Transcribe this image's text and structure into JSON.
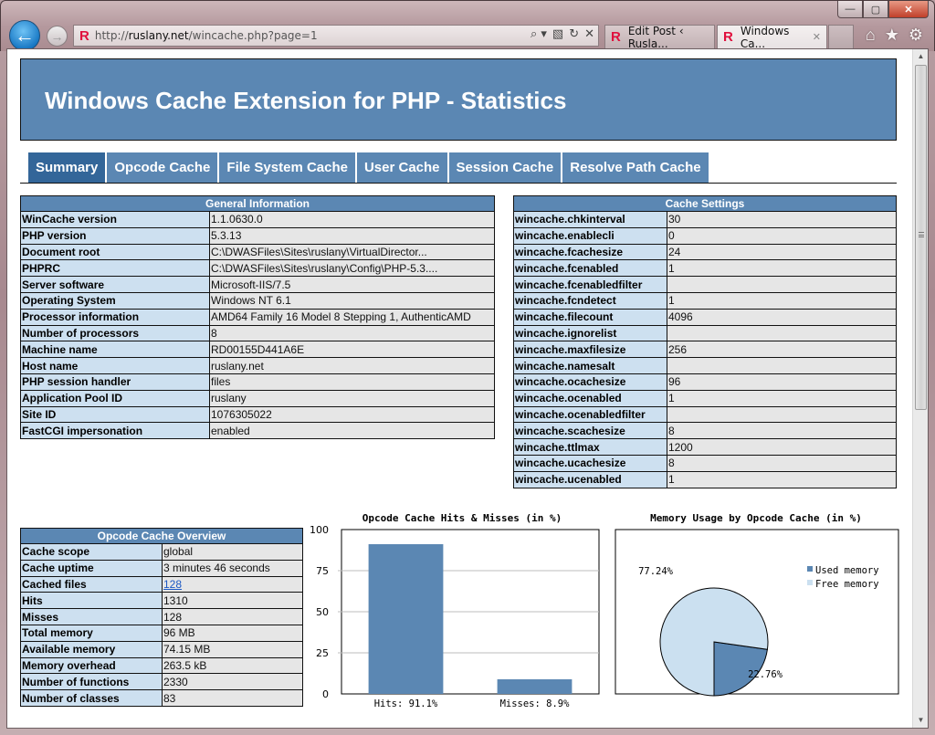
{
  "browser": {
    "address_url_prefix": "http://",
    "address_url_host": "ruslany.net",
    "address_url_path": "/wincache.php?page=1",
    "tabs": [
      {
        "label": "Edit Post ‹ Rusla...",
        "active": false
      },
      {
        "label": "Windows Ca...",
        "active": true
      }
    ],
    "favicon_glyph": "R",
    "window_controls": {
      "minimize": "—",
      "maximize": "▢",
      "close": "✕"
    },
    "icons": {
      "back": "🡐",
      "forward": "→",
      "search": "⌕ ▾",
      "compat": "▧",
      "refresh": "↻",
      "stop": "✕",
      "home": "⌂",
      "favorites": "★",
      "tools": "⚙",
      "tab_close": "✕"
    }
  },
  "header": {
    "title": "Windows Cache Extension for PHP - Statistics"
  },
  "nav_tabs": [
    {
      "label": "Summary",
      "active": true
    },
    {
      "label": "Opcode Cache",
      "active": false
    },
    {
      "label": "File System Cache",
      "active": false
    },
    {
      "label": "User Cache",
      "active": false
    },
    {
      "label": "Session Cache",
      "active": false
    },
    {
      "label": "Resolve Path Cache",
      "active": false
    }
  ],
  "general_info": {
    "title": "General Information",
    "rows": [
      {
        "key": "WinCache version",
        "value": "1.1.0630.0"
      },
      {
        "key": "PHP version",
        "value": "5.3.13"
      },
      {
        "key": "Document root",
        "value": "C:\\DWASFiles\\Sites\\ruslany\\VirtualDirector..."
      },
      {
        "key": "PHPRC",
        "value": "C:\\DWASFiles\\Sites\\ruslany\\Config\\PHP-5.3...."
      },
      {
        "key": "Server software",
        "value": "Microsoft-IIS/7.5"
      },
      {
        "key": "Operating System",
        "value": "Windows NT 6.1"
      },
      {
        "key": "Processor information",
        "value": "AMD64 Family 16 Model 8 Stepping 1, AuthenticAMD"
      },
      {
        "key": "Number of processors",
        "value": "8"
      },
      {
        "key": "Machine name",
        "value": "RD00155D441A6E"
      },
      {
        "key": "Host name",
        "value": "ruslany.net"
      },
      {
        "key": "PHP session handler",
        "value": "files"
      },
      {
        "key": "Application Pool ID",
        "value": "ruslany"
      },
      {
        "key": "Site ID",
        "value": "1076305022"
      },
      {
        "key": "FastCGI impersonation",
        "value": "enabled"
      }
    ]
  },
  "cache_settings": {
    "title": "Cache Settings",
    "rows": [
      {
        "key": "wincache.chkinterval",
        "value": "30"
      },
      {
        "key": "wincache.enablecli",
        "value": "0"
      },
      {
        "key": "wincache.fcachesize",
        "value": "24"
      },
      {
        "key": "wincache.fcenabled",
        "value": "1"
      },
      {
        "key": "wincache.fcenabledfilter",
        "value": ""
      },
      {
        "key": "wincache.fcndetect",
        "value": "1"
      },
      {
        "key": "wincache.filecount",
        "value": "4096"
      },
      {
        "key": "wincache.ignorelist",
        "value": ""
      },
      {
        "key": "wincache.maxfilesize",
        "value": "256"
      },
      {
        "key": "wincache.namesalt",
        "value": ""
      },
      {
        "key": "wincache.ocachesize",
        "value": "96"
      },
      {
        "key": "wincache.ocenabled",
        "value": "1"
      },
      {
        "key": "wincache.ocenabledfilter",
        "value": ""
      },
      {
        "key": "wincache.scachesize",
        "value": "8"
      },
      {
        "key": "wincache.ttlmax",
        "value": "1200"
      },
      {
        "key": "wincache.ucachesize",
        "value": "8"
      },
      {
        "key": "wincache.ucenabled",
        "value": "1"
      }
    ]
  },
  "opcode_overview": {
    "title": "Opcode Cache Overview",
    "rows": [
      {
        "key": "Cache scope",
        "value": "global",
        "link": false
      },
      {
        "key": "Cache uptime",
        "value": "3 minutes 46 seconds",
        "link": false
      },
      {
        "key": "Cached files",
        "value": "128",
        "link": true
      },
      {
        "key": "Hits",
        "value": "1310",
        "link": false
      },
      {
        "key": "Misses",
        "value": "128",
        "link": false
      },
      {
        "key": "Total memory",
        "value": "96 MB",
        "link": false
      },
      {
        "key": "Available memory",
        "value": "74.15 MB",
        "link": false
      },
      {
        "key": "Memory overhead",
        "value": "263.5 kB",
        "link": false
      },
      {
        "key": "Number of functions",
        "value": "2330",
        "link": false
      },
      {
        "key": "Number of classes",
        "value": "83",
        "link": false
      }
    ]
  },
  "colors": {
    "primary": "#5b87b3",
    "active_tab": "#336699",
    "key_cell": "#cde0f0",
    "value_cell": "#e6e6e6",
    "used_memory": "#5b87b3",
    "free_memory": "#cbe0f0"
  },
  "chart_data": [
    {
      "type": "bar",
      "title": "Opcode Cache Hits & Misses (in %)",
      "categories": [
        "Hits: 91.1%",
        "Misses: 8.9%"
      ],
      "values": [
        91.1,
        8.9
      ],
      "xlabel": "",
      "ylabel": "",
      "ylim": [
        0,
        100
      ],
      "yticks": [
        0,
        25,
        50,
        75,
        100
      ],
      "grid": true,
      "color": "#5b87b3"
    },
    {
      "type": "pie",
      "title": "Memory Usage by Opcode Cache (in %)",
      "labels": [
        "Used memory",
        "Free memory"
      ],
      "values": [
        22.76,
        77.24
      ],
      "data_labels": [
        "22.76%",
        "77.24%"
      ],
      "colors": [
        "#5b87b3",
        "#cbe0f0"
      ],
      "legend": "right"
    }
  ]
}
